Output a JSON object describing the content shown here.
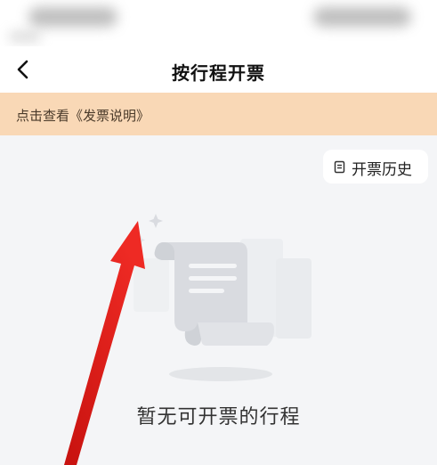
{
  "nav": {
    "title": "按行程开票"
  },
  "notice": {
    "text": "点击查看《发票说明》"
  },
  "history": {
    "label": "开票历史",
    "icon": "document-icon"
  },
  "empty_state": {
    "message": "暂无可开票的行程",
    "illustration": "empty-invoice-illustration"
  },
  "colors": {
    "background": "#f4f5f7",
    "notice_bg": "#f9d8b6",
    "annotation_arrow": "#e8201c"
  }
}
